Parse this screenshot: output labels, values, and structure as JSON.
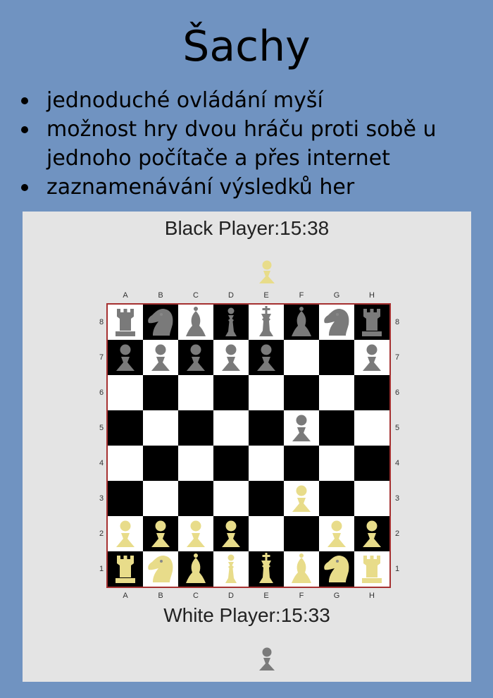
{
  "page": {
    "title": "Šachy",
    "features": [
      "jednoduché ovládání myší",
      "možnost hry dvou hráču proti sobě u jednoho počítače a přes internet",
      "zaznamenávání výsledků her"
    ]
  },
  "game": {
    "black_player": "Black Player:15:38",
    "white_player": "White Player:15:33",
    "files": [
      "A",
      "B",
      "C",
      "D",
      "E",
      "F",
      "G",
      "H"
    ],
    "ranks": [
      "8",
      "7",
      "6",
      "5",
      "4",
      "3",
      "2",
      "1"
    ],
    "colors": {
      "black_pieces": "#7a7a7a",
      "white_pieces": "#e8dc8a",
      "light_square": "#ffffff",
      "dark_square": "#000000",
      "board_border": "#a53030"
    },
    "board": [
      [
        "bR",
        "bN",
        "bB",
        "bQ",
        "bK",
        "bB",
        "bN",
        "bR"
      ],
      [
        "bP",
        "bP",
        "bP",
        "bP",
        "bP",
        "",
        "",
        "bP"
      ],
      [
        "",
        "",
        "",
        "",
        "",
        "",
        "",
        ""
      ],
      [
        "",
        "",
        "",
        "",
        "",
        "bP",
        "",
        ""
      ],
      [
        "",
        "",
        "",
        "",
        "",
        "",
        "",
        ""
      ],
      [
        "",
        "",
        "",
        "",
        "",
        "wP",
        "",
        ""
      ],
      [
        "wP",
        "wP",
        "wP",
        "wP",
        "",
        "",
        "wP",
        "wP"
      ],
      [
        "wR",
        "wN",
        "wB",
        "wQ",
        "wK",
        "wB",
        "wN",
        "wR"
      ]
    ],
    "turn_icon_top": "pawn-icon-white",
    "turn_icon_bottom": "pawn-icon-black"
  }
}
